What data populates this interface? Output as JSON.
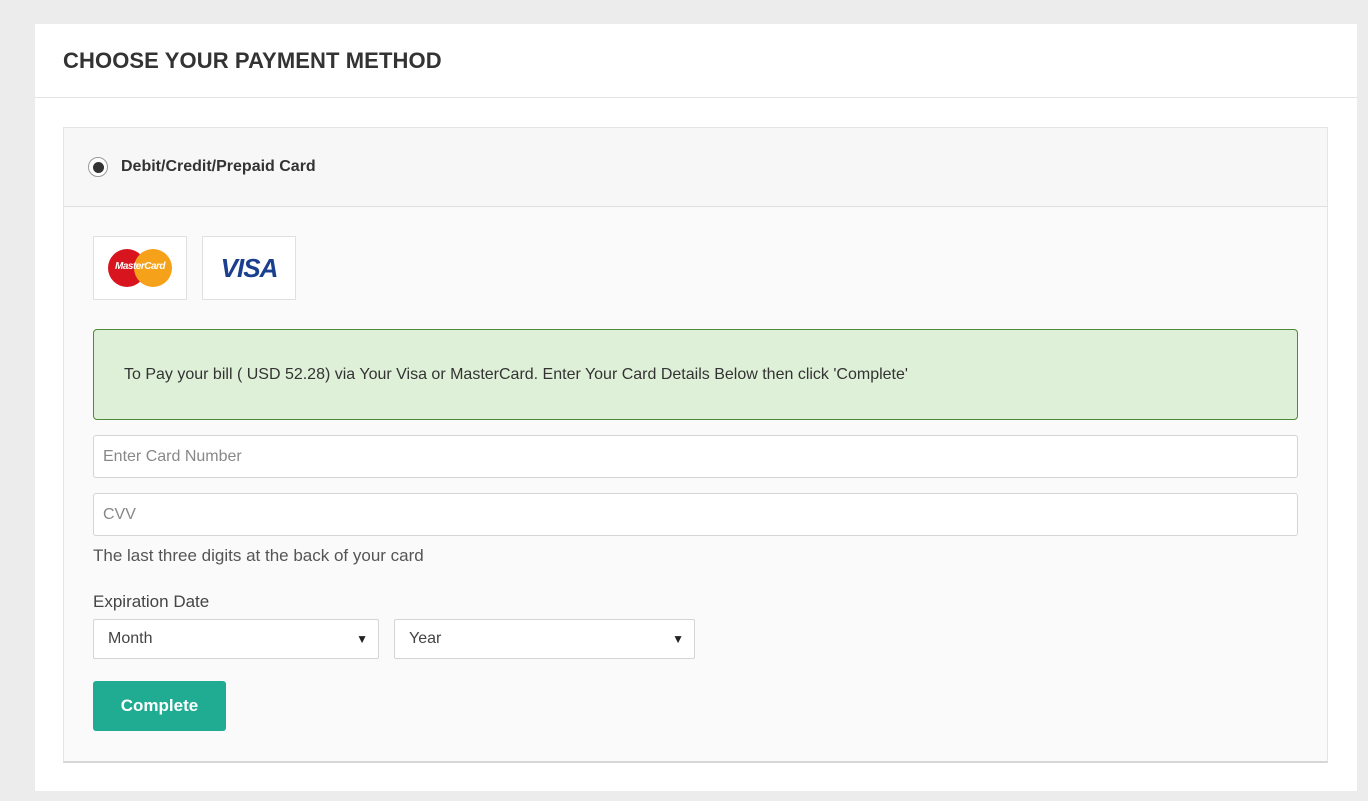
{
  "panel": {
    "title": "CHOOSE YOUR PAYMENT METHOD"
  },
  "method": {
    "label": "Debit/Credit/Prepaid Card",
    "selected": true
  },
  "cards": {
    "mastercard_text": "MasterCard",
    "visa_text": "VISA"
  },
  "alert": {
    "message": "To Pay your bill ( USD 52.28) via Your Visa or MasterCard. Enter Your Card Details Below then click 'Complete'"
  },
  "form": {
    "card_number_placeholder": "Enter Card Number",
    "card_number_value": "",
    "cvv_placeholder": "CVV",
    "cvv_value": "",
    "cvv_hint": "The last three digits at the back of your card",
    "expiration_label": "Expiration Date",
    "month_selected": "Month",
    "year_selected": "Year",
    "submit_label": "Complete"
  },
  "colors": {
    "alert_bg": "#dff0d8",
    "alert_border": "#4f8a3a",
    "button_bg": "#1fac93",
    "visa_blue": "#1a3f8f",
    "mc_red": "#d8151f",
    "mc_orange": "#f6a11a"
  }
}
